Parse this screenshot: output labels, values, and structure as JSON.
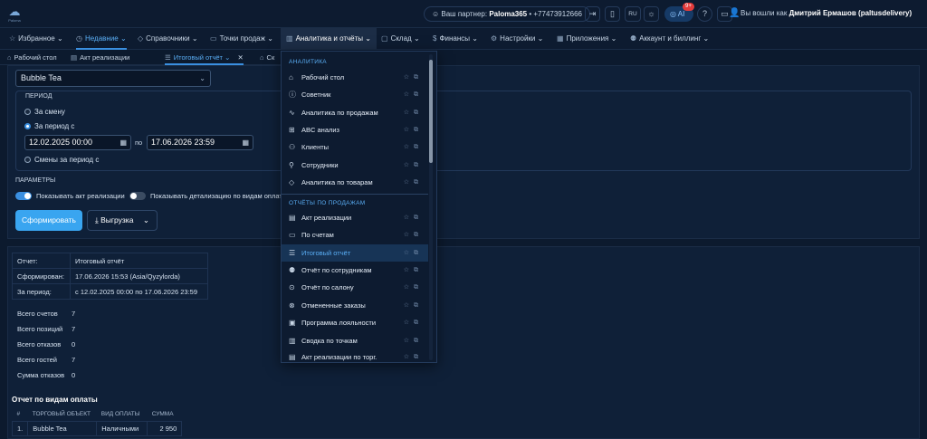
{
  "topbar": {
    "logo_text": "Paloma",
    "partner_label": "Ваш партнер:",
    "partner_name": "Paloma365",
    "partner_phone": "+77473912666",
    "lang": "RU",
    "notif_label": "AI",
    "notif_badge": "9+",
    "user_label": "Вы вошли как",
    "user_name": "Дмитрий Ермашов (paltusdelivery)"
  },
  "nav": {
    "items": [
      {
        "label": "Избранное"
      },
      {
        "label": "Недавние"
      },
      {
        "label": "Справочники"
      },
      {
        "label": "Точки продаж"
      },
      {
        "label": "Аналитика и отчёты"
      },
      {
        "label": "Склад"
      },
      {
        "label": "Финансы"
      },
      {
        "label": "Настройки"
      },
      {
        "label": "Приложения"
      },
      {
        "label": "Аккаунт и биллинг"
      }
    ]
  },
  "tabs": [
    {
      "label": "Рабочий стол"
    },
    {
      "label": "Акт реализации"
    },
    {
      "label": "Итоговый отчёт"
    },
    {
      "label": "Ск"
    }
  ],
  "filters": {
    "shop": "Bubble Tea",
    "period_label": "ПЕРИОД",
    "opt_shift": "За смену",
    "opt_period": "За период с",
    "date_from": "12.02.2025 00:00",
    "date_to_label": "по",
    "date_to": "17.06.2026 23:59",
    "opt_shifts": "Смены за период с",
    "params_label": "ПАРАМЕТРЫ",
    "toggle1": "Показывать акт реализации",
    "toggle2": "Показывать детализацию по видам оплаты",
    "btn_generate": "Сформировать",
    "btn_export": "Выгрузка"
  },
  "report": {
    "rows": [
      {
        "k": "Отчет:",
        "v": "Итоговый отчёт"
      },
      {
        "k": "Сформирован:",
        "v": "17.06.2026 15:53 (Asia/Qyzylorda)"
      },
      {
        "k": "За период:",
        "v": "с 12.02.2025 00:00 по 17.06.2026 23:59"
      }
    ],
    "stats": [
      {
        "k": "Всего счетов",
        "v": "7"
      },
      {
        "k": "Всего позиций",
        "v": "7"
      },
      {
        "k": "Всего отказов",
        "v": "0"
      },
      {
        "k": "Всего гостей",
        "v": "7"
      },
      {
        "k": "Сумма отказов",
        "v": "0"
      }
    ],
    "payment_title": "Отчет по видам оплаты",
    "payment_headers": [
      "#",
      "ТОРГОВЫЙ ОБЪЕКТ",
      "ВИД ОПЛАТЫ",
      "СУММА"
    ],
    "payment_rows": [
      {
        "n": "1.",
        "obj": "Bubble Tea",
        "type": "Наличными",
        "sum": "2 950"
      }
    ]
  },
  "dropdown": {
    "sec1": "АНАЛИТИКА",
    "items1": [
      {
        "label": "Рабочий стол",
        "icon": "home-icon"
      },
      {
        "label": "Советник",
        "icon": "info-icon"
      },
      {
        "label": "Аналитика по продажам",
        "icon": "pulse-icon"
      },
      {
        "label": "ABC анализ",
        "icon": "abc-icon"
      },
      {
        "label": "Клиенты",
        "icon": "users-icon"
      },
      {
        "label": "Сотрудники",
        "icon": "user-icon"
      },
      {
        "label": "Аналитика по товарам",
        "icon": "tag-icon"
      }
    ],
    "sec2": "ОТЧЁТЫ ПО ПРОДАЖАМ",
    "items2": [
      {
        "label": "Акт реализации",
        "icon": "doc-icon"
      },
      {
        "label": "По счетам",
        "icon": "receipt-icon"
      },
      {
        "label": "Итоговый отчёт",
        "icon": "list-icon"
      },
      {
        "label": "Отчёт по сотрудникам",
        "icon": "team-icon"
      },
      {
        "label": "Отчёт по салону",
        "icon": "pin-icon"
      },
      {
        "label": "Отмененные заказы",
        "icon": "cancel-icon"
      },
      {
        "label": "Программа лояльности",
        "icon": "gift-icon"
      },
      {
        "label": "Сводка по точкам",
        "icon": "bars-icon"
      },
      {
        "label": "Акт реализации по торг.",
        "icon": "doc-icon"
      }
    ]
  }
}
